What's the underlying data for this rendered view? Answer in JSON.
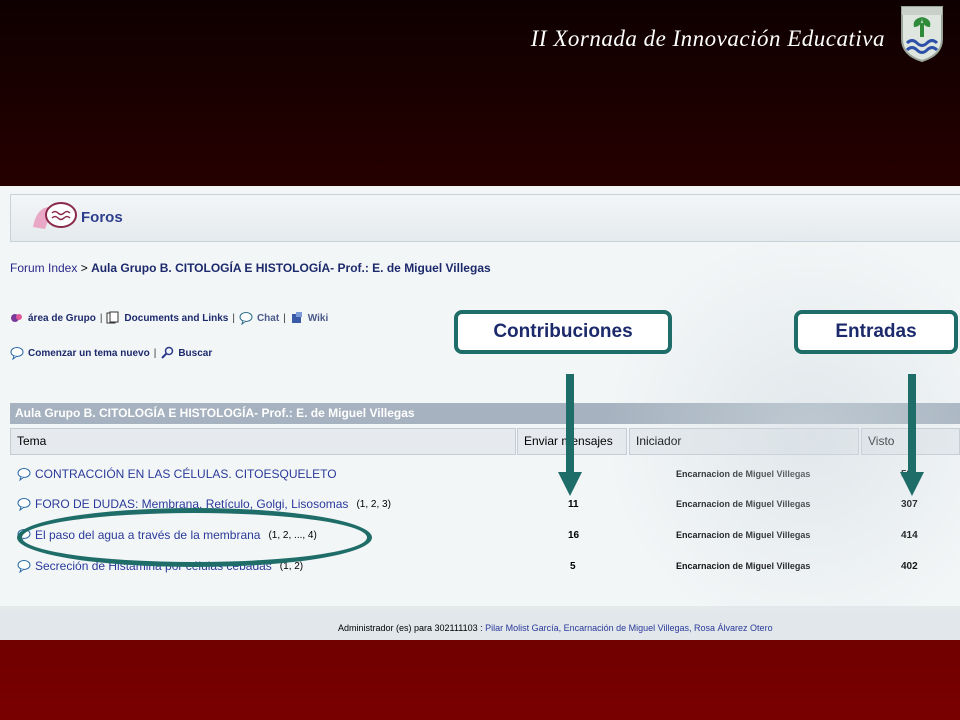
{
  "slide": {
    "title": "II Xornada de Innovación Educativa"
  },
  "forum": {
    "section_label": "Foros",
    "breadcrumb_root": "Forum Index",
    "breadcrumb_sep": ">",
    "breadcrumb_current": "Aula Grupo B. CITOLOGÍA E HISTOLOGÍA- Prof.: E. de Miguel Villegas",
    "toolbar": [
      {
        "label": "área de Grupo",
        "icon": "group-area-icon"
      },
      {
        "label": "Documents and Links",
        "icon": "documents-icon"
      },
      {
        "label": "Chat",
        "icon": "chat-icon"
      },
      {
        "label": "Wiki",
        "icon": "wiki-icon"
      }
    ],
    "actions": [
      {
        "label": "Comenzar un tema nuevo",
        "icon": "new-topic-icon"
      },
      {
        "label": "Buscar",
        "icon": "search-icon"
      }
    ],
    "table_title": "Aula Grupo B. CITOLOGÍA E HISTOLOGÍA- Prof.: E. de Miguel Villegas",
    "columns": [
      "Tema",
      "Enviar mensajes",
      "Iniciador",
      "Visto"
    ],
    "rows": [
      {
        "topic": "CONTRACCIÓN EN LAS CÉLULAS. CITOESQUELETO",
        "pages": "",
        "replies": "",
        "author": "Encarnacion de Miguel Villegas",
        "views": "58"
      },
      {
        "topic": "FORO DE DUDAS: Membrana, Retículo, Golgi, Lisosomas",
        "pages": "(1, 2, 3)",
        "replies": "11",
        "author": "Encarnacion de Miguel Villegas",
        "views": "307"
      },
      {
        "topic": "El paso del agua a través de la membrana",
        "pages": "(1, 2, ..., 4)",
        "replies": "16",
        "author": "Encarnacion de Miguel Villegas",
        "views": "414"
      },
      {
        "topic": "Secreción de Histamina por células cebadas",
        "pages": "(1, 2)",
        "replies": "5",
        "author": "Encarnacion de Miguel Villegas",
        "views": "402"
      }
    ],
    "footer_prefix": "Administrador (es) para 302111103 :",
    "footer_admins": "Pilar Molist García, Encarnación de Miguel Villegas, Rosa Álvarez Otero"
  },
  "annotations": {
    "contributions_label": "Contribuciones",
    "entries_label": "Entradas",
    "accent_color": "#1f6d68"
  }
}
